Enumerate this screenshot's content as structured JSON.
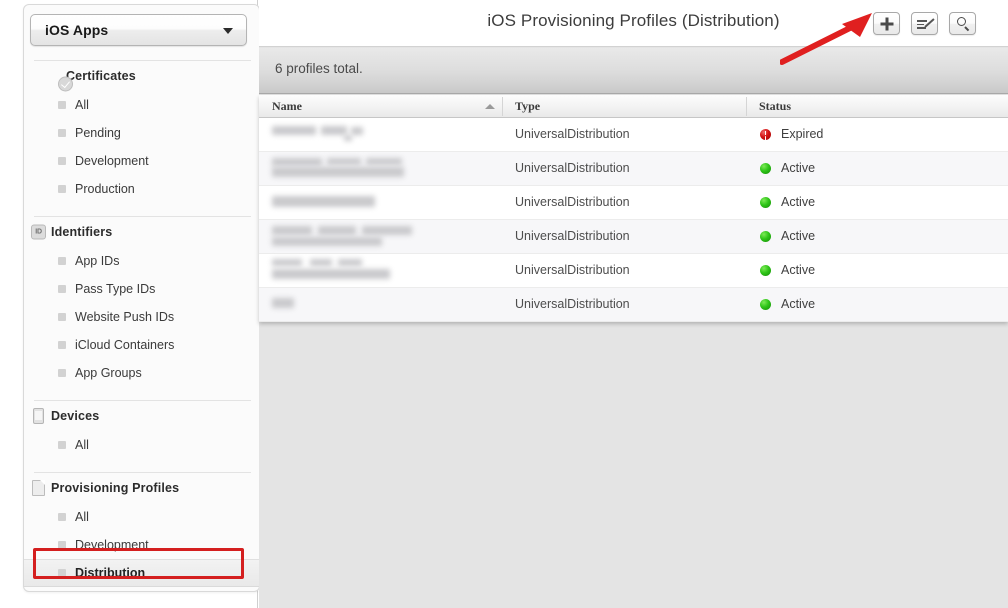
{
  "sidebar": {
    "app_select": {
      "label": "iOS Apps",
      "caret_icon": "chevron-down-icon"
    },
    "groups": [
      {
        "title": "Certificates",
        "icon": "certificate-seal-icon",
        "items": [
          {
            "label": "All",
            "selected": false
          },
          {
            "label": "Pending",
            "selected": false
          },
          {
            "label": "Development",
            "selected": false
          },
          {
            "label": "Production",
            "selected": false
          }
        ]
      },
      {
        "title": "Identifiers",
        "icon": "id-badge-icon",
        "items": [
          {
            "label": "App IDs",
            "selected": false
          },
          {
            "label": "Pass Type IDs",
            "selected": false
          },
          {
            "label": "Website Push IDs",
            "selected": false
          },
          {
            "label": "iCloud Containers",
            "selected": false
          },
          {
            "label": "App Groups",
            "selected": false
          }
        ]
      },
      {
        "title": "Devices",
        "icon": "device-phone-icon",
        "items": [
          {
            "label": "All",
            "selected": false
          }
        ]
      },
      {
        "title": "Provisioning Profiles",
        "icon": "document-icon",
        "items": [
          {
            "label": "All",
            "selected": false
          },
          {
            "label": "Development",
            "selected": false
          },
          {
            "label": "Distribution",
            "selected": true
          }
        ]
      }
    ]
  },
  "header": {
    "title": "iOS Provisioning Profiles (Distribution)",
    "buttons": [
      {
        "name": "add-profile-button",
        "icon": "plus-icon"
      },
      {
        "name": "edit-profiles-button",
        "icon": "edit-pencil-icon"
      },
      {
        "name": "search-button",
        "icon": "search-icon"
      }
    ]
  },
  "summary": {
    "text": "6 profiles total."
  },
  "table": {
    "columns": [
      "Name",
      "Type",
      "Status"
    ],
    "sort": {
      "column": "Name",
      "direction": "ascending",
      "icon": "sort-ascending-icon"
    },
    "rows": [
      {
        "name": "",
        "name_redacted": true,
        "type": "UniversalDistribution",
        "status": "Expired",
        "status_icon": "error-circle-icon"
      },
      {
        "name": "",
        "name_redacted": true,
        "type": "UniversalDistribution",
        "status": "Active",
        "status_icon": "active-dot-icon"
      },
      {
        "name": "",
        "name_redacted": true,
        "type": "UniversalDistribution",
        "status": "Active",
        "status_icon": "active-dot-icon"
      },
      {
        "name": "",
        "name_redacted": true,
        "type": "UniversalDistribution",
        "status": "Active",
        "status_icon": "active-dot-icon"
      },
      {
        "name": "",
        "name_redacted": true,
        "type": "UniversalDistribution",
        "status": "Active",
        "status_icon": "active-dot-icon"
      },
      {
        "name": "",
        "name_redacted": true,
        "type": "UniversalDistribution",
        "status": "Active",
        "status_icon": "active-dot-icon"
      }
    ]
  },
  "annotations": {
    "arrow_color": "#e02020",
    "highlight_box_color": "#d41f1f",
    "highlight_target": "Distribution",
    "arrow_target": "add-profile-button"
  },
  "colors": {
    "status_active": "#2fc518",
    "status_expired": "#d31212",
    "annotation_red": "#d41f1f"
  }
}
